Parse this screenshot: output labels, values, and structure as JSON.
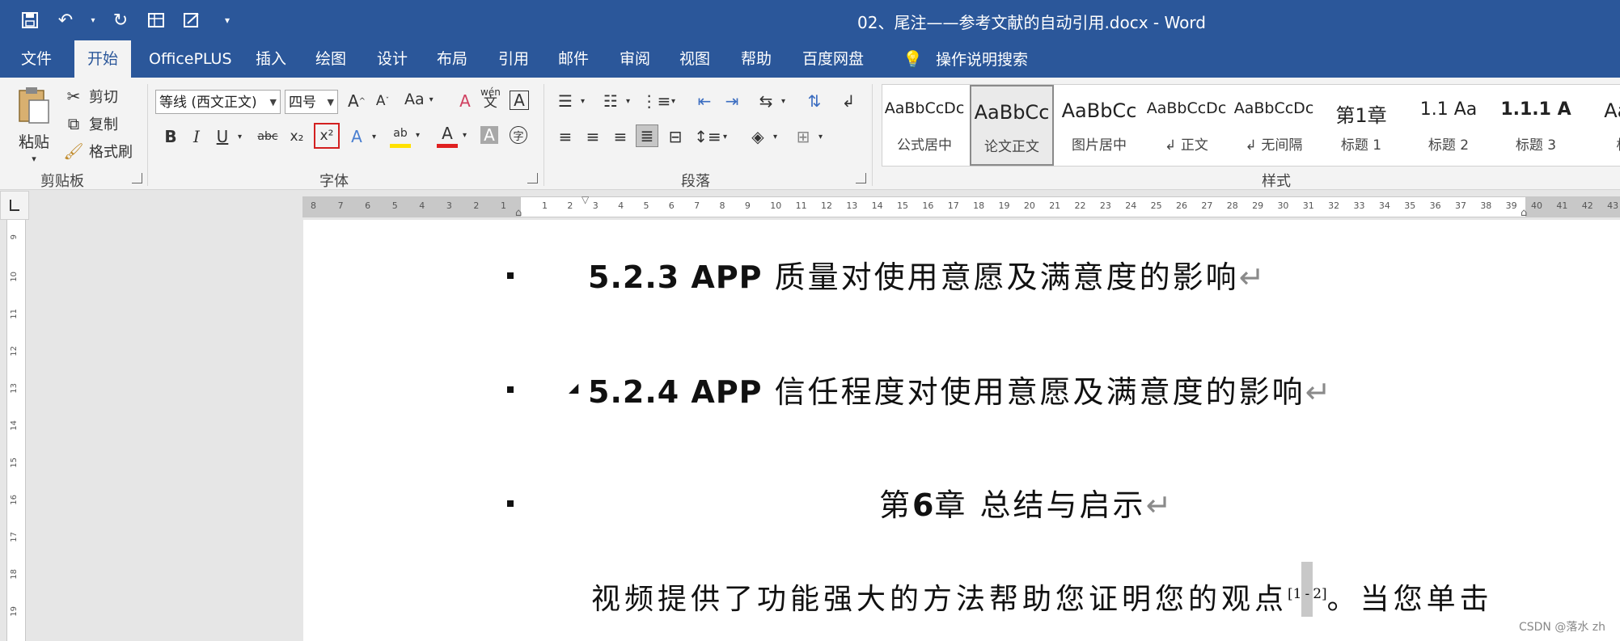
{
  "app": {
    "title": "02、尾注——参考文献的自动引用.docx  -  Word"
  },
  "quick_access": [
    "save-icon",
    "undo-icon",
    "redo-icon",
    "table-icon",
    "form-icon",
    "customize-icon"
  ],
  "menu": {
    "tabs": [
      "文件",
      "开始",
      "OfficePLUS",
      "插入",
      "绘图",
      "设计",
      "布局",
      "引用",
      "邮件",
      "审阅",
      "视图",
      "帮助",
      "百度网盘"
    ],
    "active": "开始",
    "search": "操作说明搜索"
  },
  "ribbon": {
    "clipboard": {
      "paste": "粘贴",
      "cut": "剪切",
      "copy": "复制",
      "format_painter": "格式刷",
      "label": "剪贴板"
    },
    "font": {
      "font_name": "等线 (西文正文)",
      "font_size": "四号",
      "change_case": "Aa",
      "phonetic": "wén\n文",
      "label": "字体",
      "buttons": [
        "B",
        "I",
        "U",
        "abc",
        "x₂",
        "x²"
      ]
    },
    "paragraph": {
      "label": "段落"
    },
    "styles": {
      "label": "样式",
      "items": [
        {
          "preview": "AaBbCcDc",
          "name": "公式居中"
        },
        {
          "preview": "AaBbCc",
          "name": "论文正文"
        },
        {
          "preview": "AaBbCc",
          "name": "图片居中"
        },
        {
          "preview": "AaBbCcDc",
          "name": "↲ 正文"
        },
        {
          "preview": "AaBbCcDc",
          "name": "↲ 无间隔"
        },
        {
          "preview": "第1章",
          "name": "标题 1"
        },
        {
          "preview": "1.1  Aa",
          "name": "标题 2"
        },
        {
          "preview": "1.1.1  A",
          "name": "标题 3"
        },
        {
          "preview": "AaB",
          "name": "标"
        }
      ],
      "selected_index": 1
    }
  },
  "ruler": {
    "horizontal_left_ticks": [
      "8",
      "7",
      "6",
      "5",
      "4",
      "3",
      "2",
      "1"
    ],
    "horizontal_right_ticks": [
      "1",
      "2",
      "3",
      "4",
      "5",
      "6",
      "7",
      "8",
      "9",
      "10",
      "11",
      "12",
      "13",
      "14",
      "15",
      "16",
      "17",
      "18",
      "19",
      "20",
      "21",
      "22",
      "23",
      "24",
      "25",
      "26",
      "27",
      "28",
      "29",
      "30",
      "31",
      "32",
      "33",
      "34",
      "35",
      "36",
      "37",
      "38",
      "39",
      "40",
      "41",
      "42",
      "43"
    ],
    "vertical_ticks": [
      "9",
      "10",
      "11",
      "12",
      "13",
      "14",
      "15",
      "16",
      "17",
      "18",
      "19"
    ]
  },
  "document": {
    "h1_num": "5.2.3 APP",
    "h1_text": " 质量对使用意愿及满意度的影响",
    "h2_num": "5.2.4 APP",
    "h2_text": " 信任程度对使用意愿及满意度的影响",
    "h3_pre": "第",
    "h3_num": "6",
    "h3_text": "章 总结与启示",
    "paragraph_mark": "↵",
    "collapse_marker": "◢",
    "body_text": "视频提供了功能强大的方法帮助您证明您的观点",
    "citation_open": "[1",
    "citation_dash": "-",
    "citation_close": "2]",
    "body_tail": "。当您单击"
  },
  "watermark": "CSDN @落水 zh"
}
